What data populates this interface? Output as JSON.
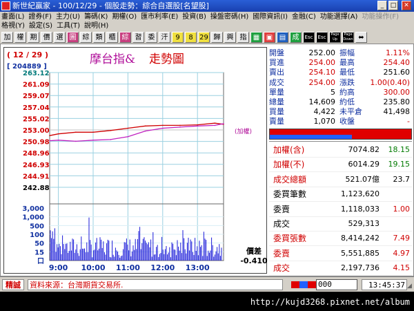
{
  "window": {
    "title": "新世紀贏家 - 100/12/29 - 個股走勢：綜合自選股[名望股]",
    "buttons": {
      "minimize": "_",
      "maximize": "□",
      "close": "✕"
    }
  },
  "menu": {
    "row1": [
      "畫面(L)",
      "證券(F)",
      "主力(U)",
      "籌碼(K)",
      "期權(O)",
      "匯市利率(E)",
      "投資(B)",
      "操盤密碼(H)",
      "國際資訊(I)",
      "金融(C)",
      "功能選擇(A)"
    ],
    "row1_dim": "功能操作(F)",
    "row2": [
      "格視(Y)",
      "設定(S)",
      "工具(T)",
      "說明(H)"
    ]
  },
  "toolbar": {
    "buttons": [
      "加",
      "權",
      "期",
      "價",
      "選",
      "圖",
      "綜",
      "類",
      "櫃",
      "綜",
      "習",
      "委",
      "汗",
      "9",
      "8",
      "29",
      "歸",
      "興",
      "指",
      "▦",
      "▣",
      "▤",
      "成",
      "Esc",
      "Esc",
      "Page Up",
      "Page Down",
      "⬌"
    ]
  },
  "chart": {
    "date_label": "( 12 / 29 )",
    "volume_label": "[ 204889 ]",
    "title_a": "摩台指&",
    "title_b": "走勢圖",
    "weighted_label": "(加權)",
    "diff_label": "價差",
    "diff_value": "-0.410",
    "price_ticks": [
      "263.12",
      "261.09",
      "259.07",
      "257.04",
      "255.02",
      "253.00",
      "250.98",
      "248.96",
      "246.93",
      "244.91",
      "242.88"
    ],
    "volume_ticks": [
      "3,000",
      "1,000",
      "500",
      "100",
      "50",
      "15",
      "口"
    ],
    "time_ticks": [
      "9:00",
      "10:00",
      "11:00",
      "12:00",
      "13:00"
    ]
  },
  "chart_data": {
    "type": "line",
    "title": "摩台指& 走勢圖",
    "x_labels": [
      "9:00",
      "10:00",
      "11:00",
      "12:00",
      "13:00"
    ],
    "ylim": [
      242.88,
      263.12
    ],
    "reference_price": 253.0,
    "series": [
      {
        "name": "",
        "color": "#d00000",
        "x": [
          "08:45",
          "09:00",
          "09:30",
          "10:00",
          "10:30",
          "11:00",
          "11:30",
          "12:00",
          "12:30",
          "13:00",
          "13:30",
          "13:45"
        ],
        "values": [
          252.0,
          252.3,
          252.6,
          252.6,
          252.9,
          253.3,
          253.7,
          253.8,
          253.8,
          253.9,
          254.2,
          254.0
        ]
      },
      {
        "name": "加權",
        "color": "#c020c0",
        "x": [
          "08:45",
          "09:00",
          "09:30",
          "10:00",
          "10:30",
          "11:00",
          "11:30",
          "12:00",
          "12:30",
          "13:00",
          "13:30",
          "13:45"
        ],
        "values": [
          251.1,
          251.2,
          251.0,
          251.2,
          251.3,
          251.8,
          252.8,
          253.3,
          253.5,
          253.7,
          253.8,
          254.1
        ]
      }
    ]
  },
  "quote": {
    "rows": [
      {
        "l1": "開盤",
        "v1": "252.00",
        "c1": "#000",
        "l2": "振幅",
        "v2": "1.11%",
        "c2": "#d00000"
      },
      {
        "l1": "買進",
        "v1": "254.00",
        "c1": "#d00000",
        "l2": "最高",
        "v2": "254.40",
        "c2": "#d00000"
      },
      {
        "l1": "賣出",
        "v1": "254.10",
        "c1": "#d00000",
        "l2": "最低",
        "v2": "251.60",
        "c2": "#000"
      },
      {
        "l1": "成交",
        "v1": "254.00",
        "c1": "#d00000",
        "l2": "漲跌",
        "v2": "1.00(0.40)",
        "c2": "#d00000"
      },
      {
        "l1": "單量",
        "v1": "5",
        "c1": "#000",
        "l2": "約高",
        "v2": "300.00",
        "c2": "#d00000"
      },
      {
        "l1": "總量",
        "v1": "14,609",
        "c1": "#000",
        "l2": "約低",
        "v2": "235.80",
        "c2": "#000"
      },
      {
        "l1": "買量",
        "v1": "4,422",
        "c1": "#000",
        "l2": "未平倉",
        "v2": "41,498",
        "c2": "#000"
      },
      {
        "l1": "賣量",
        "v1": "1,070",
        "c1": "#000",
        "l2": "收盤",
        "v2": "-",
        "c2": "#d00000"
      }
    ],
    "index_rows": [
      {
        "label": "加權(含)",
        "value": "7074.82",
        "change": "18.15",
        "lc": "#d00000",
        "cc": "#007a00"
      },
      {
        "label": "加權(不)",
        "value": "6014.29",
        "change": "19.15",
        "lc": "#d00000",
        "cc": "#007a00"
      },
      {
        "label": "成交總額",
        "value": "521.07億",
        "change": "23.7",
        "lc": "#d00000",
        "cc": "#000"
      },
      {
        "label": "委買筆數",
        "value": "1,123,620",
        "change": "",
        "lc": "#000",
        "cc": "#000"
      },
      {
        "label": "委賣",
        "value": "1,118,033",
        "change": "1.00",
        "lc": "#000",
        "cc": "#d00000"
      },
      {
        "label": "成交",
        "value": "529,313",
        "change": "",
        "lc": "#000",
        "cc": "#000"
      },
      {
        "label": "委買張數",
        "value": "8,414,242",
        "change": "7.49",
        "lc": "#d00000",
        "cc": "#d00000"
      },
      {
        "label": "委賣",
        "value": "5,551,885",
        "change": "4.97",
        "lc": "#d00000",
        "cc": "#d00000"
      },
      {
        "label": "成交",
        "value": "2,197,736",
        "change": "4.15",
        "lc": "#d00000",
        "cc": "#d00000"
      }
    ],
    "ratio_bar": {
      "buy_fraction": 0.58
    }
  },
  "status": {
    "badge": "精誠",
    "source": "資料來源：台灣期貨交易所.",
    "input_value": "000",
    "clock": "13:45:37"
  },
  "footer": {
    "url": "http://kujd3268.pixnet.net/album"
  }
}
